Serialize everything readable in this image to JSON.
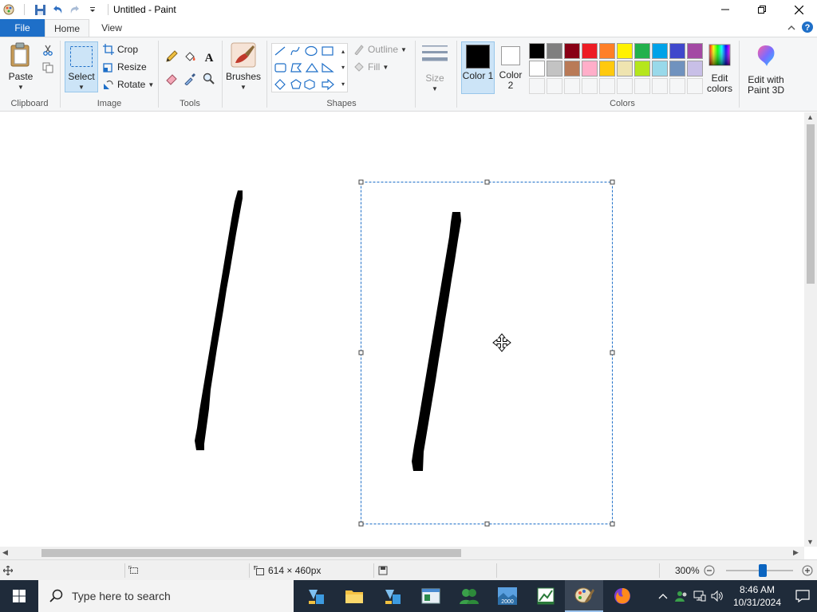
{
  "window": {
    "title": "Untitled - Paint"
  },
  "tabs": {
    "file": "File",
    "home": "Home",
    "view": "View"
  },
  "ribbon": {
    "clipboard": {
      "label": "Clipboard",
      "paste": "Paste"
    },
    "image": {
      "label": "Image",
      "select": "Select",
      "crop": "Crop",
      "resize": "Resize",
      "rotate": "Rotate"
    },
    "tools": {
      "label": "Tools"
    },
    "brushes": {
      "label": "Brushes"
    },
    "shapes": {
      "label": "Shapes",
      "outline": "Outline",
      "fill": "Fill"
    },
    "size": {
      "label": "Size"
    },
    "colors": {
      "label": "Colors",
      "color1": "Color 1",
      "color1_value": "#000000",
      "color2": "Color 2",
      "color2_value": "#ffffff",
      "edit_colors": "Edit colors",
      "edit_with_paint3d": "Edit with Paint 3D",
      "palette_row1": [
        "#000000",
        "#7f7f7f",
        "#880015",
        "#ed1c24",
        "#ff7f27",
        "#fff200",
        "#22b14c",
        "#00a2e8",
        "#3f48cc",
        "#a349a4"
      ],
      "palette_row2": [
        "#ffffff",
        "#c3c3c3",
        "#b97a57",
        "#ffaec9",
        "#ffc90e",
        "#efe4b0",
        "#b5e61d",
        "#99d9ea",
        "#7092be",
        "#c8bfe7"
      ]
    }
  },
  "status": {
    "canvas_size": "614 × 460px",
    "zoom": "300%",
    "zoom_level_fraction": 0.55
  },
  "taskbar": {
    "search_placeholder": "Type here to search",
    "time": "8:46 AM",
    "date": "10/31/2024"
  }
}
